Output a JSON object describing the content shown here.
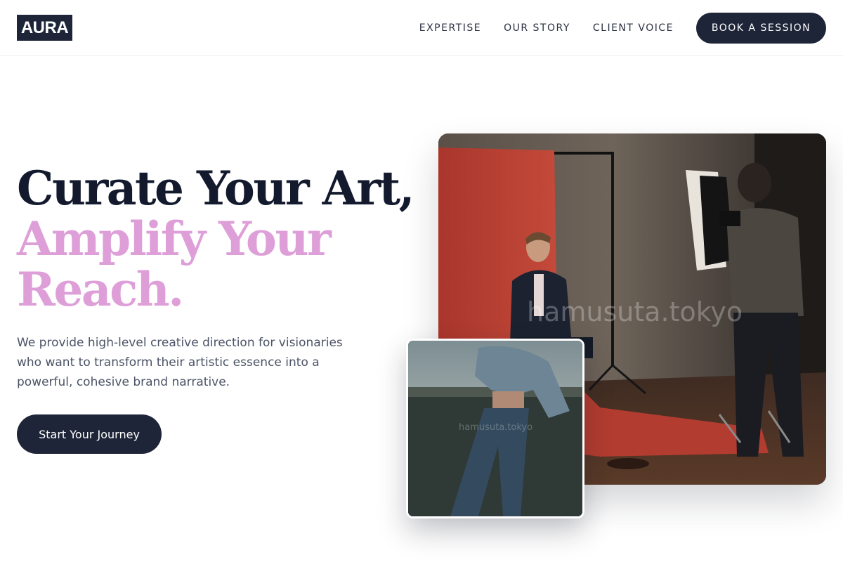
{
  "brand": {
    "logo_text": "AURA"
  },
  "nav": {
    "links": [
      "EXPERTISE",
      "OUR STORY",
      "CLIENT VOICE"
    ],
    "cta_label": "BOOK A SESSION"
  },
  "hero": {
    "headline_line1": "Curate Your Art,",
    "headline_line2": "Amplify Your",
    "headline_line3": "Reach.",
    "description": "We provide high-level creative direction for visionaries who want to transform their artistic essence into a powerful, cohesive brand narrative.",
    "cta_label": "Start Your Journey"
  },
  "images": {
    "main": {
      "subject": "photo-studio-shoot",
      "watermark": "hamusuta.tokyo"
    },
    "secondary": {
      "subject": "denim-fashion-portrait",
      "watermark": "hamusuta.tokyo"
    }
  },
  "colors": {
    "primary_dark": "#1e2538",
    "headline_dark": "#131a2e",
    "accent_pink": "#de9fd9",
    "body_text": "#4b5366",
    "studio_red": "#b8392e"
  }
}
